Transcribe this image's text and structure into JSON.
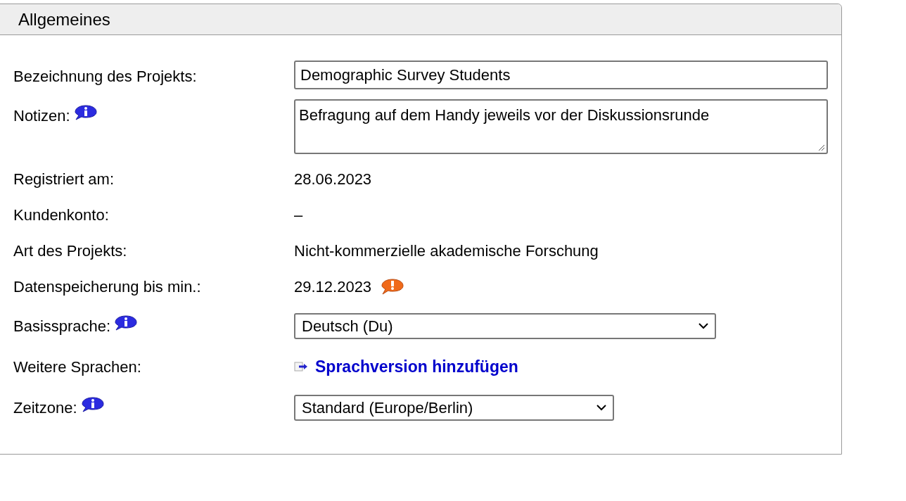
{
  "panel": {
    "title": "Allgemeines"
  },
  "fields": [
    {
      "kind": "input",
      "label": "Bezeichnung des Projekts:",
      "info": false,
      "value": "Demographic Survey Students"
    },
    {
      "kind": "textarea",
      "label": "Notizen:",
      "info": true,
      "value": "Befragung auf dem Handy jeweils vor der Diskussionsrunde"
    },
    {
      "kind": "text",
      "label": "Registriert am:",
      "info": false,
      "value": "28.06.2023",
      "warning": false
    },
    {
      "kind": "text",
      "label": "Kundenkonto:",
      "info": false,
      "value": "–",
      "warning": false
    },
    {
      "kind": "text",
      "label": "Art des Projekts:",
      "info": false,
      "value": "Nicht-kommerzielle akademische Forschung",
      "warning": false
    },
    {
      "kind": "text",
      "label": "Datenspeicherung bis min.:",
      "info": false,
      "value": "29.12.2023",
      "warning": true
    },
    {
      "kind": "select",
      "label": "Basissprache:",
      "info": true,
      "value": "Deutsch (Du)"
    },
    {
      "kind": "link",
      "label": "Weitere Sprachen:",
      "info": false,
      "value": "Sprachversion hinzufügen"
    },
    {
      "kind": "select",
      "label": "Zeitzone:",
      "info": true,
      "value": "Standard (Europe/Berlin)"
    }
  ]
}
